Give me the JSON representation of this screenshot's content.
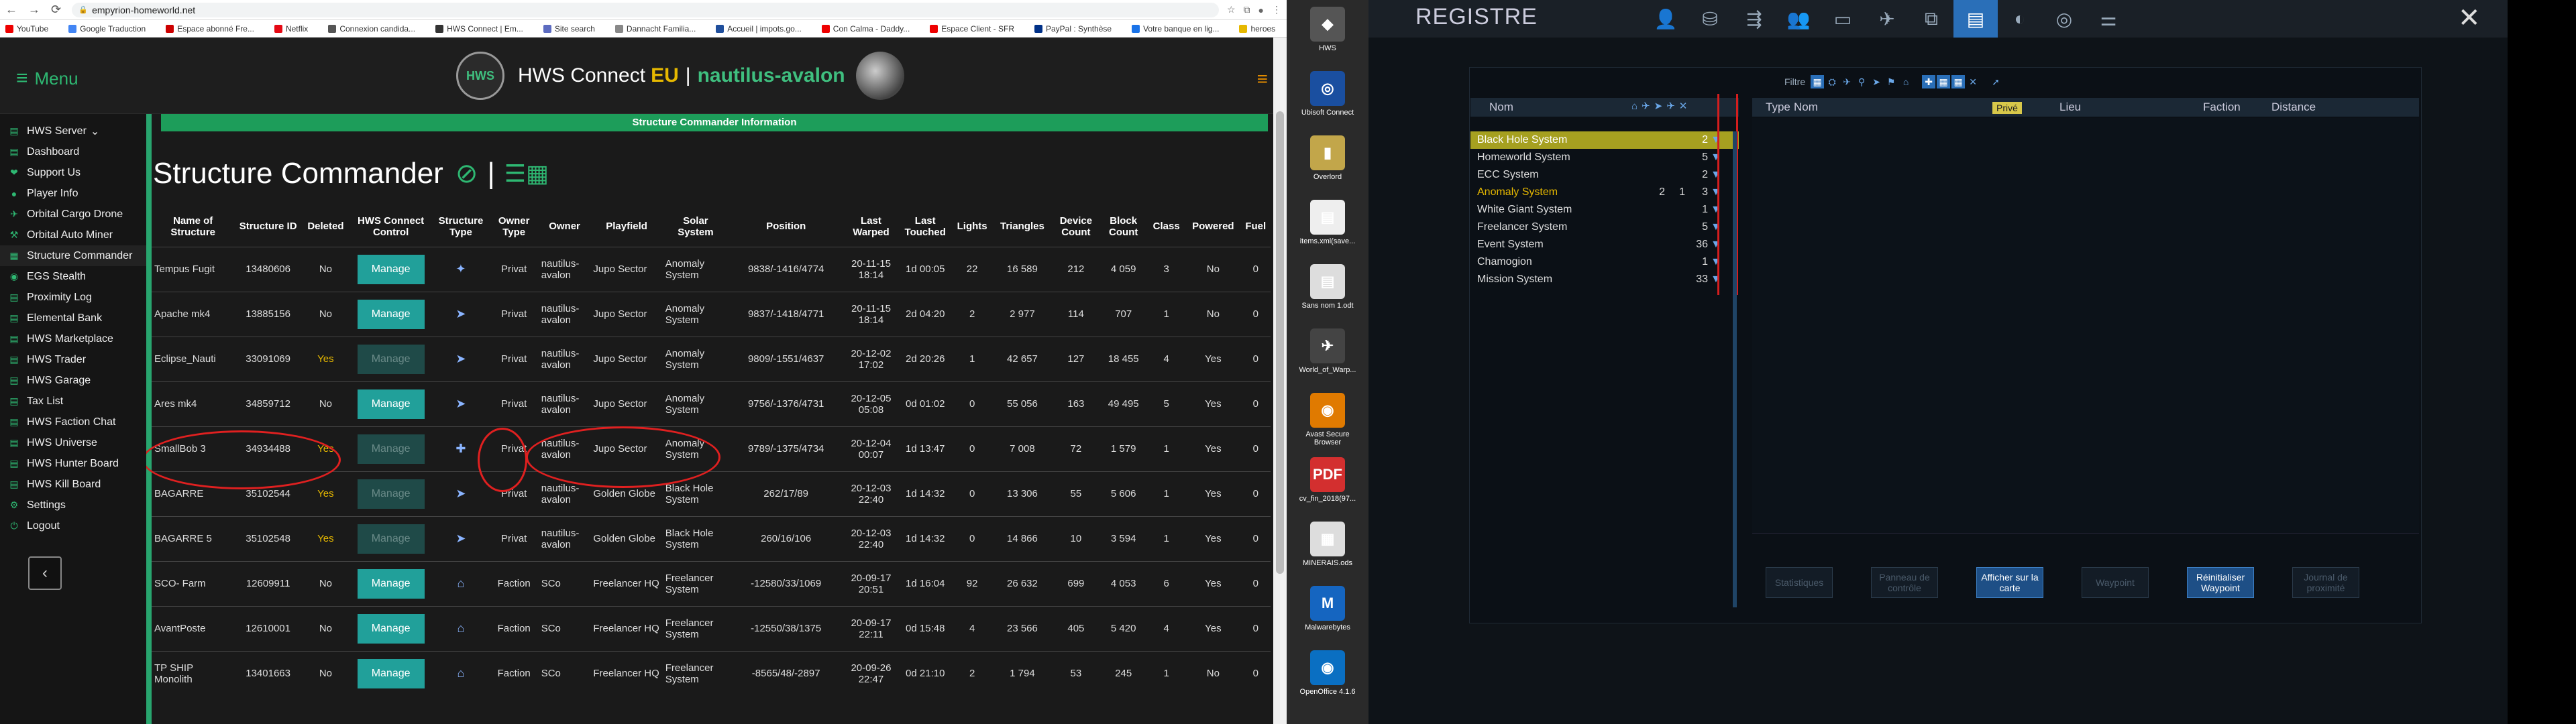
{
  "browser": {
    "url": "empyrion-homeworld.net",
    "bookmarks": [
      "YouTube",
      "Google Traduction",
      "Espace abonné Fre...",
      "Netflix",
      "Connexion candida...",
      "HWS Connect | Em...",
      "Site search",
      "Dannacht Familia...",
      "Accueil | impots.go...",
      "Con Calma - Daddy...",
      "Espace Client - SFR",
      "PayPal : Synthèse",
      "Votre banque en lig...",
      "heroes"
    ],
    "bookmark_colors": [
      "#e00",
      "#4285f4",
      "#c00",
      "#e50914",
      "#555",
      "#333",
      "#5c6bc0",
      "#888",
      "#1f4e9c",
      "#e00",
      "#e00",
      "#003087",
      "#1a73e8",
      "#e6b800"
    ]
  },
  "site": {
    "menu_label": "Menu",
    "brand_text": "HWS Connect",
    "brand_eu": "EU",
    "brand_sep": "|",
    "server_name": "nautilus-avalon",
    "logo_text": "HWS"
  },
  "sidebar": {
    "items": [
      {
        "label": "HWS Server",
        "icon": "server-icon",
        "glyph": "▤"
      },
      {
        "label": "Dashboard",
        "icon": "dashboard-icon",
        "glyph": "▤"
      },
      {
        "label": "Support Us",
        "icon": "heart-icon",
        "glyph": "❤"
      },
      {
        "label": "Player Info",
        "icon": "user-icon",
        "glyph": "●"
      },
      {
        "label": "Orbital Cargo Drone",
        "icon": "drone-icon",
        "glyph": "✈"
      },
      {
        "label": "Orbital Auto Miner",
        "icon": "miner-icon",
        "glyph": "⚒"
      },
      {
        "label": "Structure Commander",
        "icon": "structure-icon",
        "glyph": "▦"
      },
      {
        "label": "EGS Stealth",
        "icon": "stealth-icon",
        "glyph": "◉"
      },
      {
        "label": "Proximity Log",
        "icon": "log-icon",
        "glyph": "▤"
      },
      {
        "label": "Elemental Bank",
        "icon": "bank-icon",
        "glyph": "▤"
      },
      {
        "label": "HWS Marketplace",
        "icon": "market-icon",
        "glyph": "▤"
      },
      {
        "label": "HWS Trader",
        "icon": "trader-icon",
        "glyph": "▤"
      },
      {
        "label": "HWS Garage",
        "icon": "garage-icon",
        "glyph": "▤"
      },
      {
        "label": "Tax List",
        "icon": "tax-icon",
        "glyph": "▤"
      },
      {
        "label": "HWS Faction Chat",
        "icon": "chat-icon",
        "glyph": "▤"
      },
      {
        "label": "HWS Universe",
        "icon": "universe-icon",
        "glyph": "▤"
      },
      {
        "label": "HWS Hunter Board",
        "icon": "hunter-icon",
        "glyph": "▤"
      },
      {
        "label": "HWS Kill Board",
        "icon": "kill-icon",
        "glyph": "▤"
      },
      {
        "label": "Settings",
        "icon": "gear-icon",
        "glyph": "⚙"
      },
      {
        "label": "Logout",
        "icon": "logout-icon",
        "glyph": "⏻"
      }
    ]
  },
  "main": {
    "info_bar": "Structure Commander Information",
    "title": "Structure Commander",
    "title_sep": "|",
    "columns": [
      "Name of Structure",
      "Structure ID",
      "Deleted",
      "HWS Connect Control",
      "Structure Type",
      "Owner Type",
      "Owner",
      "Playfield",
      "Solar System",
      "Position",
      "Last Warped",
      "Last Touched",
      "Lights",
      "Triangles",
      "Device Count",
      "Block Count",
      "Class",
      "Powered",
      "Fuel"
    ],
    "rows": [
      {
        "name": "Tempus Fugit",
        "id": "13480606",
        "deleted": "No",
        "control": "Manage",
        "enabled": true,
        "type": "CV",
        "glyph": "✦",
        "owner_type": "Privat",
        "owner": "nautilus-avalon",
        "playfield": "Jupo Sector",
        "system": "Anomaly System",
        "position": "9838/-1416/4774",
        "warped": "20-11-15 18:14",
        "touched": "1d 00:05",
        "lights": "22",
        "triangles": "16 589",
        "devices": "212",
        "blocks": "4 059",
        "class": "3",
        "powered": "No",
        "fuel": "0"
      },
      {
        "name": "Apache mk4",
        "id": "13885156",
        "deleted": "No",
        "control": "Manage",
        "enabled": true,
        "type": "SV",
        "glyph": "➤",
        "owner_type": "Privat",
        "owner": "nautilus-avalon",
        "playfield": "Jupo Sector",
        "system": "Anomaly System",
        "position": "9837/-1418/4771",
        "warped": "20-11-15 18:14",
        "touched": "2d 04:20",
        "lights": "2",
        "triangles": "2 977",
        "devices": "114",
        "blocks": "707",
        "class": "1",
        "powered": "No",
        "fuel": "0"
      },
      {
        "name": "Eclipse_Nauti",
        "id": "33091069",
        "deleted": "Yes",
        "control": "Manage",
        "enabled": false,
        "type": "SV",
        "glyph": "➤",
        "owner_type": "Privat",
        "owner": "nautilus-avalon",
        "playfield": "Jupo Sector",
        "system": "Anomaly System",
        "position": "9809/-1551/4637",
        "warped": "20-12-02 17:02",
        "touched": "2d 20:26",
        "lights": "1",
        "triangles": "42 657",
        "devices": "127",
        "blocks": "18 455",
        "class": "4",
        "powered": "Yes",
        "fuel": "0"
      },
      {
        "name": "Ares mk4",
        "id": "34859712",
        "deleted": "No",
        "control": "Manage",
        "enabled": true,
        "type": "SV",
        "glyph": "➤",
        "owner_type": "Privat",
        "owner": "nautilus-avalon",
        "playfield": "Jupo Sector",
        "system": "Anomaly System",
        "position": "9756/-1376/4731",
        "warped": "20-12-05 05:08",
        "touched": "0d 01:02",
        "lights": "0",
        "triangles": "55 056",
        "devices": "163",
        "blocks": "49 495",
        "class": "5",
        "powered": "Yes",
        "fuel": "0"
      },
      {
        "name": "SmallBob 3",
        "id": "34934488",
        "deleted": "Yes",
        "control": "Manage",
        "enabled": false,
        "type": "HV",
        "glyph": "✚",
        "owner_type": "Privat",
        "owner": "nautilus-avalon",
        "playfield": "Jupo Sector",
        "system": "Anomaly System",
        "position": "9789/-1375/4734",
        "warped": "20-12-04 00:07",
        "touched": "1d 13:47",
        "lights": "0",
        "triangles": "7 008",
        "devices": "72",
        "blocks": "1 579",
        "class": "1",
        "powered": "Yes",
        "fuel": "0"
      },
      {
        "name": "BAGARRE",
        "id": "35102544",
        "deleted": "Yes",
        "control": "Manage",
        "enabled": false,
        "type": "SV",
        "glyph": "➤",
        "owner_type": "Privat",
        "owner": "nautilus-avalon",
        "playfield": "Golden Globe",
        "system": "Black Hole System",
        "position": "262/17/89",
        "warped": "20-12-03 22:40",
        "touched": "1d 14:32",
        "lights": "0",
        "triangles": "13 306",
        "devices": "55",
        "blocks": "5 606",
        "class": "1",
        "powered": "Yes",
        "fuel": "0"
      },
      {
        "name": "BAGARRE 5",
        "id": "35102548",
        "deleted": "Yes",
        "control": "Manage",
        "enabled": false,
        "type": "SV",
        "glyph": "➤",
        "owner_type": "Privat",
        "owner": "nautilus-avalon",
        "playfield": "Golden Globe",
        "system": "Black Hole System",
        "position": "260/16/106",
        "warped": "20-12-03 22:40",
        "touched": "1d 14:32",
        "lights": "0",
        "triangles": "14 866",
        "devices": "10",
        "blocks": "3 594",
        "class": "1",
        "powered": "Yes",
        "fuel": "0"
      },
      {
        "name": "SCO- Farm",
        "id": "12609911",
        "deleted": "No",
        "control": "Manage",
        "enabled": true,
        "type": "BA",
        "glyph": "⌂",
        "owner_type": "Faction",
        "owner": "SCo",
        "playfield": "Freelancer HQ",
        "system": "Freelancer System",
        "position": "-12580/33/1069",
        "warped": "20-09-17 20:51",
        "touched": "1d 16:04",
        "lights": "92",
        "triangles": "26 632",
        "devices": "699",
        "blocks": "4 053",
        "class": "6",
        "powered": "Yes",
        "fuel": "0"
      },
      {
        "name": "AvantPoste",
        "id": "12610001",
        "deleted": "No",
        "control": "Manage",
        "enabled": true,
        "type": "BA",
        "glyph": "⌂",
        "owner_type": "Faction",
        "owner": "SCo",
        "playfield": "Freelancer HQ",
        "system": "Freelancer System",
        "position": "-12550/38/1375",
        "warped": "20-09-17 22:11",
        "touched": "0d 15:48",
        "lights": "4",
        "triangles": "23 566",
        "devices": "405",
        "blocks": "5 420",
        "class": "4",
        "powered": "Yes",
        "fuel": "0"
      },
      {
        "name": "TP SHIP Monolith",
        "id": "13401663",
        "deleted": "No",
        "control": "Manage",
        "enabled": true,
        "type": "BA",
        "glyph": "⌂",
        "owner_type": "Faction",
        "owner": "SCo",
        "playfield": "Freelancer HQ",
        "system": "Freelancer System",
        "position": "-8565/48/-2897",
        "warped": "20-09-26 22:47",
        "touched": "0d 21:10",
        "lights": "2",
        "triangles": "1 794",
        "devices": "53",
        "blocks": "245",
        "class": "1",
        "powered": "No",
        "fuel": "0"
      }
    ]
  },
  "desktop": {
    "icons": [
      {
        "label": "HWS",
        "glyph": "◆",
        "color": "#555"
      },
      {
        "label": "Ubisoft Connect",
        "glyph": "◎",
        "color": "#1a4fa0"
      },
      {
        "label": "Overlord",
        "glyph": "▮",
        "color": "#c2a64a"
      },
      {
        "label": "items.xml(save...",
        "glyph": "▤",
        "color": "#eee"
      },
      {
        "label": "Sans nom 1.odt",
        "glyph": "▤",
        "color": "#ddd"
      },
      {
        "label": "World_of_Warp...",
        "glyph": "✈",
        "color": "#444"
      },
      {
        "label": "Avast Secure Browser",
        "glyph": "◉",
        "color": "#e07a00"
      },
      {
        "label": "cv_fin_2018(97...",
        "glyph": "PDF",
        "color": "#d32f2f"
      },
      {
        "label": "MINERAIS.ods",
        "glyph": "▦",
        "color": "#ddd"
      },
      {
        "label": "Malwarebytes",
        "glyph": "M",
        "color": "#1565c0"
      },
      {
        "label": "OpenOffice 4.1.6",
        "glyph": "◉",
        "color": "#0a6fc2"
      }
    ]
  },
  "game": {
    "title": "REGISTRE",
    "tabs": [
      "user-icon",
      "hierarchy-icon",
      "network-icon",
      "group-icon",
      "book-icon",
      "ship-icon",
      "puzzle-icon",
      "registry-icon",
      "compass-icon",
      "galaxy-icon",
      "sliders-icon"
    ],
    "tab_glyphs": [
      "👤",
      "⛁",
      "⇶",
      "👥",
      "▭",
      "✈",
      "⧉",
      "▤",
      "◐",
      "◎",
      "⚌"
    ],
    "active_tab": 7,
    "filter_label": "Filtre",
    "filter_glyphs": [
      "▦",
      "⛭",
      "✈",
      "⚲",
      "➤",
      "⚑",
      "⌂",
      "✚",
      "▦",
      "▦",
      "✕",
      "➚"
    ],
    "left_header": {
      "nom": "Nom"
    },
    "left_rows": [
      {
        "name": "Black Hole System",
        "a": "",
        "b": "",
        "count": "2",
        "highlight": true,
        "warn": false
      },
      {
        "name": "Homeworld System",
        "a": "",
        "b": "",
        "count": "5",
        "highlight": false,
        "warn": false
      },
      {
        "name": "ECC System",
        "a": "",
        "b": "",
        "count": "2",
        "highlight": false,
        "warn": false
      },
      {
        "name": "Anomaly System",
        "a": "2",
        "b": "1",
        "count": "3",
        "highlight": false,
        "warn": true
      },
      {
        "name": "White Giant System",
        "a": "",
        "b": "",
        "count": "1",
        "highlight": false,
        "warn": false
      },
      {
        "name": "Freelancer System",
        "a": "",
        "b": "",
        "count": "5",
        "highlight": false,
        "warn": false
      },
      {
        "name": "Event System",
        "a": "",
        "b": "",
        "count": "36",
        "highlight": false,
        "warn": false
      },
      {
        "name": "Chamogion",
        "a": "",
        "b": "",
        "count": "1",
        "highlight": false,
        "warn": false
      },
      {
        "name": "Mission System",
        "a": "",
        "b": "",
        "count": "33",
        "highlight": false,
        "warn": false
      }
    ],
    "right_header": {
      "type": "Type",
      "nom": "Nom",
      "prive": "Privé",
      "lieu": "Lieu",
      "faction": "Faction",
      "distance": "Distance"
    },
    "buttons": [
      {
        "label": "Statistiques",
        "on": false
      },
      {
        "label": "Panneau de contrôle",
        "on": false
      },
      {
        "label": "Afficher sur la carte",
        "on": true
      },
      {
        "label": "Waypoint",
        "on": false
      },
      {
        "label": "Réinitialiser Waypoint",
        "on": true
      },
      {
        "label": "Journal de proximité",
        "on": false
      }
    ]
  }
}
